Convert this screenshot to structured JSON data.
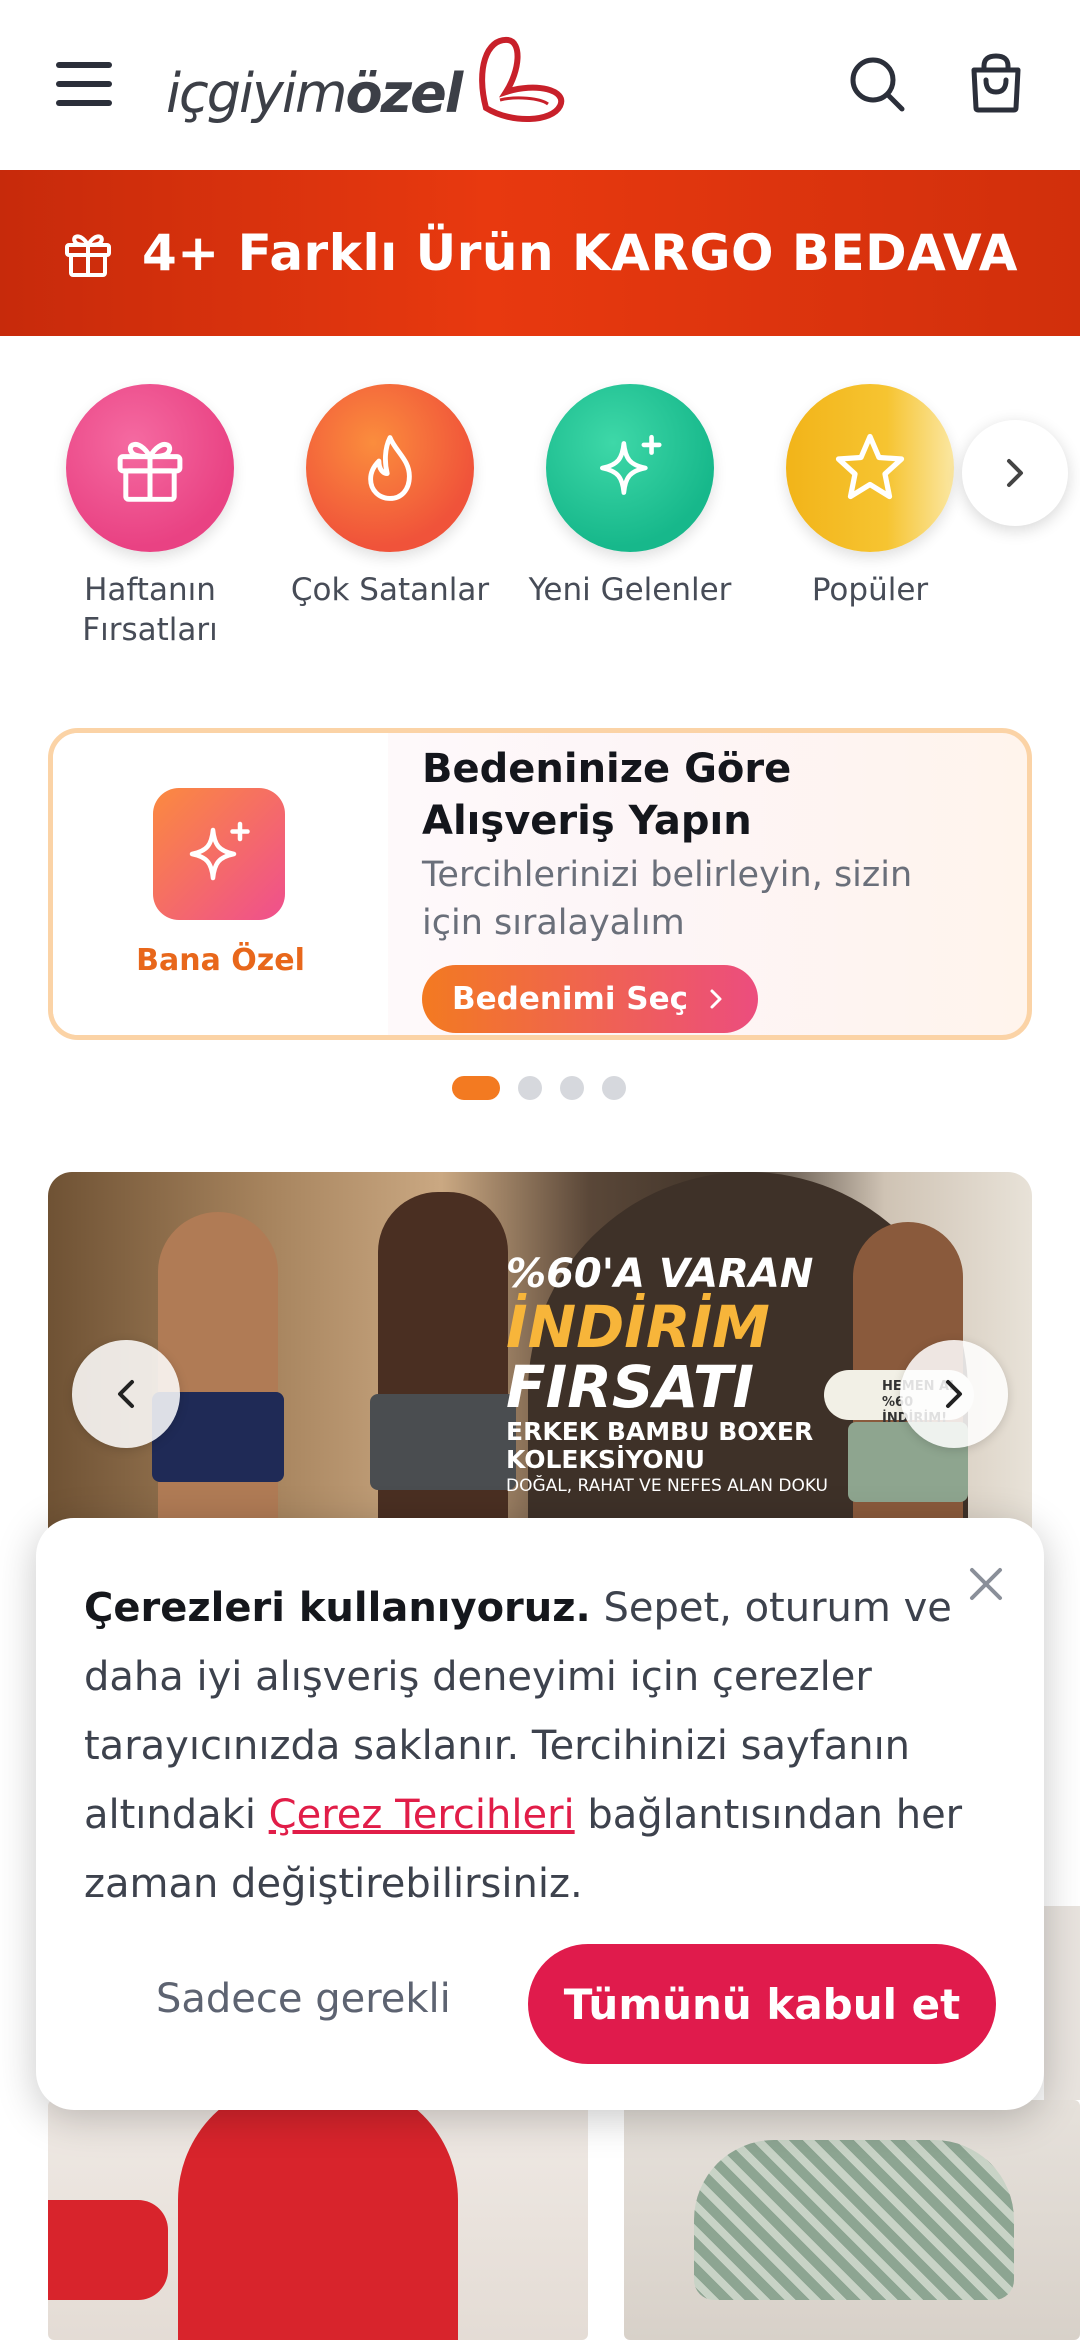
{
  "header": {
    "logo_prefix": "içgiyim",
    "logo_suffix": "özel",
    "menu_icon": "menu-icon",
    "search_icon": "search-icon",
    "cart_icon": "shopping-bag-icon"
  },
  "promo": {
    "text": "4+ Farklı Ürün KARGO BEDAVA",
    "icon": "gift-icon"
  },
  "categories": [
    {
      "label": "Haftanın Fırsatları",
      "icon": "gift-icon",
      "color": "#ee4f8e"
    },
    {
      "label": "Çok Satanlar",
      "icon": "flame-icon",
      "color": "#f76a2f"
    },
    {
      "label": "Yeni Gelenler",
      "icon": "sparkle-icon",
      "color": "#20c997"
    },
    {
      "label": "Popüler",
      "icon": "star-icon",
      "color": "#f2b419"
    }
  ],
  "personal_card": {
    "icon_label": "Bana Özel",
    "title": "Bedeninize Göre Alışveriş Yapın",
    "subtitle": "Tercihlerinizi belirleyin, sizin için sıralayalım",
    "button_label": "Bedenimi Seç"
  },
  "slider": {
    "count": 4,
    "active": 1
  },
  "hero": {
    "line1": "%60'A VARAN",
    "line2": "İNDİRİM",
    "line3": "FIRSATI",
    "line4a": "ERKEK BAMBU BOXER",
    "line4b": "KOLEKSİYONU",
    "line5": "DOĞAL, RAHAT VE NEFES ALAN DOKU",
    "badge_line1": "HEMEN AL",
    "badge_line2": "%60 İNDİRİM!"
  },
  "cookie": {
    "bold": "Çerezleri kullanıyoruz.",
    "text1": " Sepet, oturum ve daha iyi alışveriş deneyimi için çerezler tarayıcınızda saklanır. Tercihinizi sayfanın altındaki ",
    "link": "Çerez Tercihleri",
    "text2": " bağlantısından her zaman değiştirebilirsiniz.",
    "necessary_label": "Sadece gerekli",
    "accept_label": "Tümünü kabul et"
  }
}
